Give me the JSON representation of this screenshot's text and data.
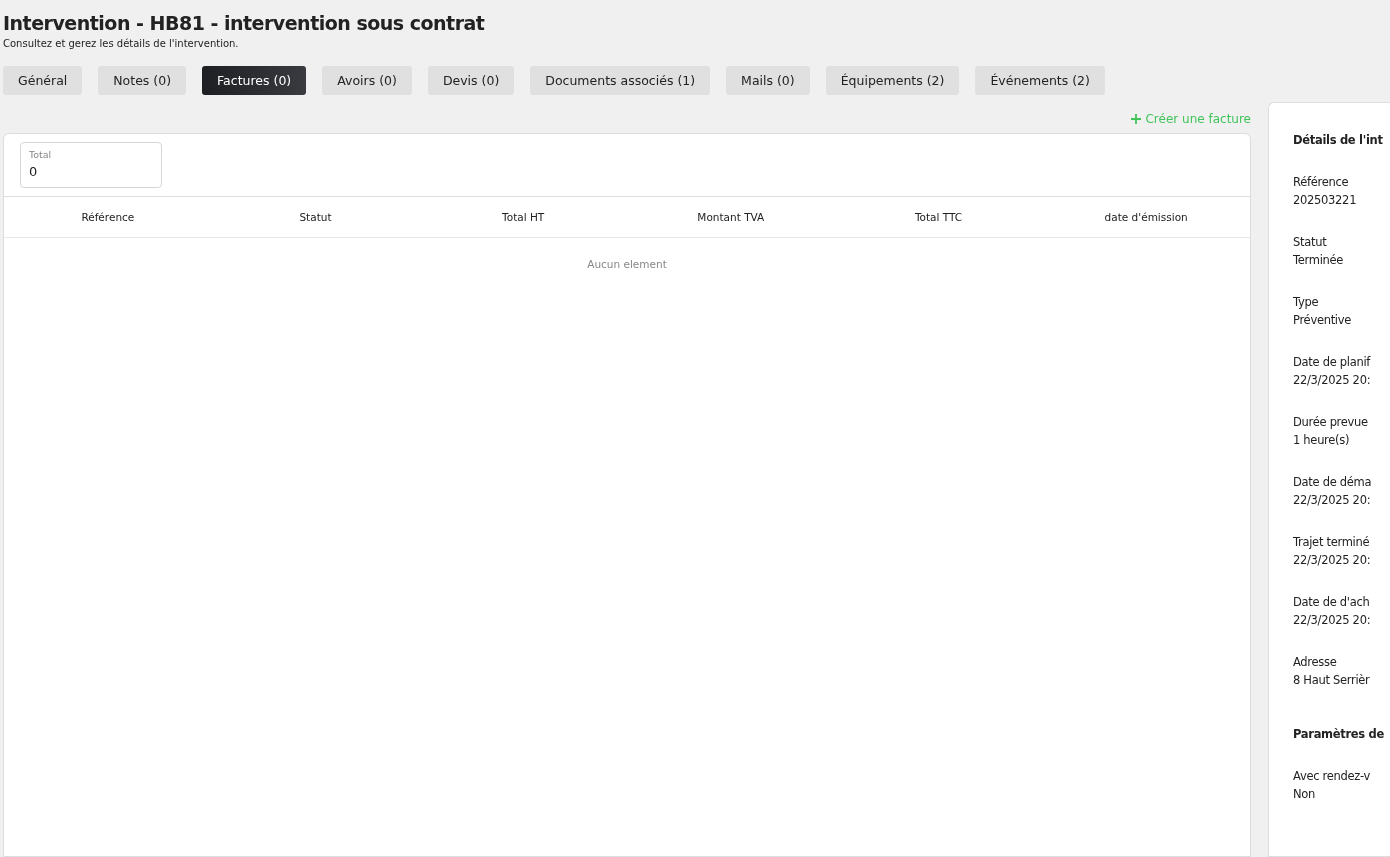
{
  "page": {
    "title": "Intervention - HB81 - intervention sous contrat",
    "subtitle": "Consultez et gerez les détails de l'intervention."
  },
  "tabs": [
    {
      "label": "Général",
      "selected": false
    },
    {
      "label": "Notes (0)",
      "selected": false
    },
    {
      "label": "Factures (0)",
      "selected": true
    },
    {
      "label": "Avoirs (0)",
      "selected": false
    },
    {
      "label": "Devis (0)",
      "selected": false
    },
    {
      "label": "Documents associés (1)",
      "selected": false
    },
    {
      "label": "Mails (0)",
      "selected": false
    },
    {
      "label": "Équipements (2)",
      "selected": false
    },
    {
      "label": "Événements (2)",
      "selected": false
    }
  ],
  "create_link": {
    "label": "Créer une facture"
  },
  "total": {
    "label": "Total",
    "value": "0"
  },
  "table": {
    "columns": [
      "Référence",
      "Statut",
      "Total HT",
      "Montant TVA",
      "Total TTC",
      "date d'émission"
    ],
    "empty_text": "Aucun element"
  },
  "details": {
    "title": "Détails de l'int",
    "fields": [
      {
        "label": "Référence",
        "value": "202503221"
      },
      {
        "label": "Statut",
        "value": "Terminée"
      },
      {
        "label": "Type",
        "value": "Préventive"
      },
      {
        "label": "Date de planif",
        "value": "22/3/2025 20:"
      },
      {
        "label": "Durée prevue",
        "value": "1 heure(s)"
      },
      {
        "label": "Date de déma",
        "value": "22/3/2025 20:"
      },
      {
        "label": "Trajet terminé",
        "value": "22/3/2025 20:"
      },
      {
        "label": "Date de d'ach",
        "value": "22/3/2025 20:"
      },
      {
        "label": "Adresse",
        "value": "8 Haut Serrièr"
      }
    ],
    "section_title": "Paramètres de",
    "section_fields": [
      {
        "label": "Avec rendez-v",
        "value": "Non"
      }
    ]
  }
}
